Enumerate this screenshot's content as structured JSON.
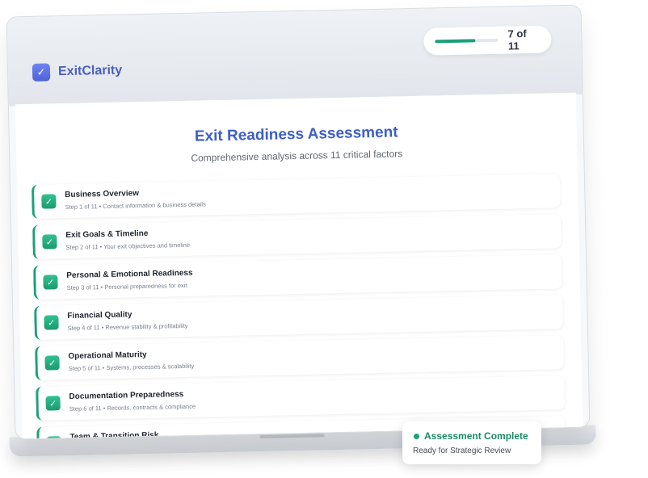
{
  "app": {
    "name": "ExitClarity",
    "logo_icon": "check-icon"
  },
  "progress": {
    "label": "7 of 11",
    "current": 7,
    "total": 11,
    "accent": "#1aa079"
  },
  "header": {
    "title": "Exit Readiness Assessment",
    "subtitle": "Comprehensive analysis across 11 critical factors"
  },
  "steps": [
    {
      "title": "Business Overview",
      "subtitle": "Step 1 of 11 • Contact information & business details"
    },
    {
      "title": "Exit Goals & Timeline",
      "subtitle": "Step 2 of 11 • Your exit objectives and timeline"
    },
    {
      "title": "Personal & Emotional Readiness",
      "subtitle": "Step 3 of 11 • Personal preparedness for exit"
    },
    {
      "title": "Financial Quality",
      "subtitle": "Step 4 of 11 • Revenue stability & profitability"
    },
    {
      "title": "Operational Maturity",
      "subtitle": "Step 5 of 11 • Systems, processes & scalability"
    },
    {
      "title": "Documentation Preparedness",
      "subtitle": "Step 6 of 11 • Records, contracts & compliance"
    },
    {
      "title": "Team & Transition Risk",
      "subtitle": ""
    }
  ],
  "toast": {
    "title": "Assessment Complete",
    "subtitle": "Ready for Strategic Review",
    "status_color": "#19a374"
  }
}
